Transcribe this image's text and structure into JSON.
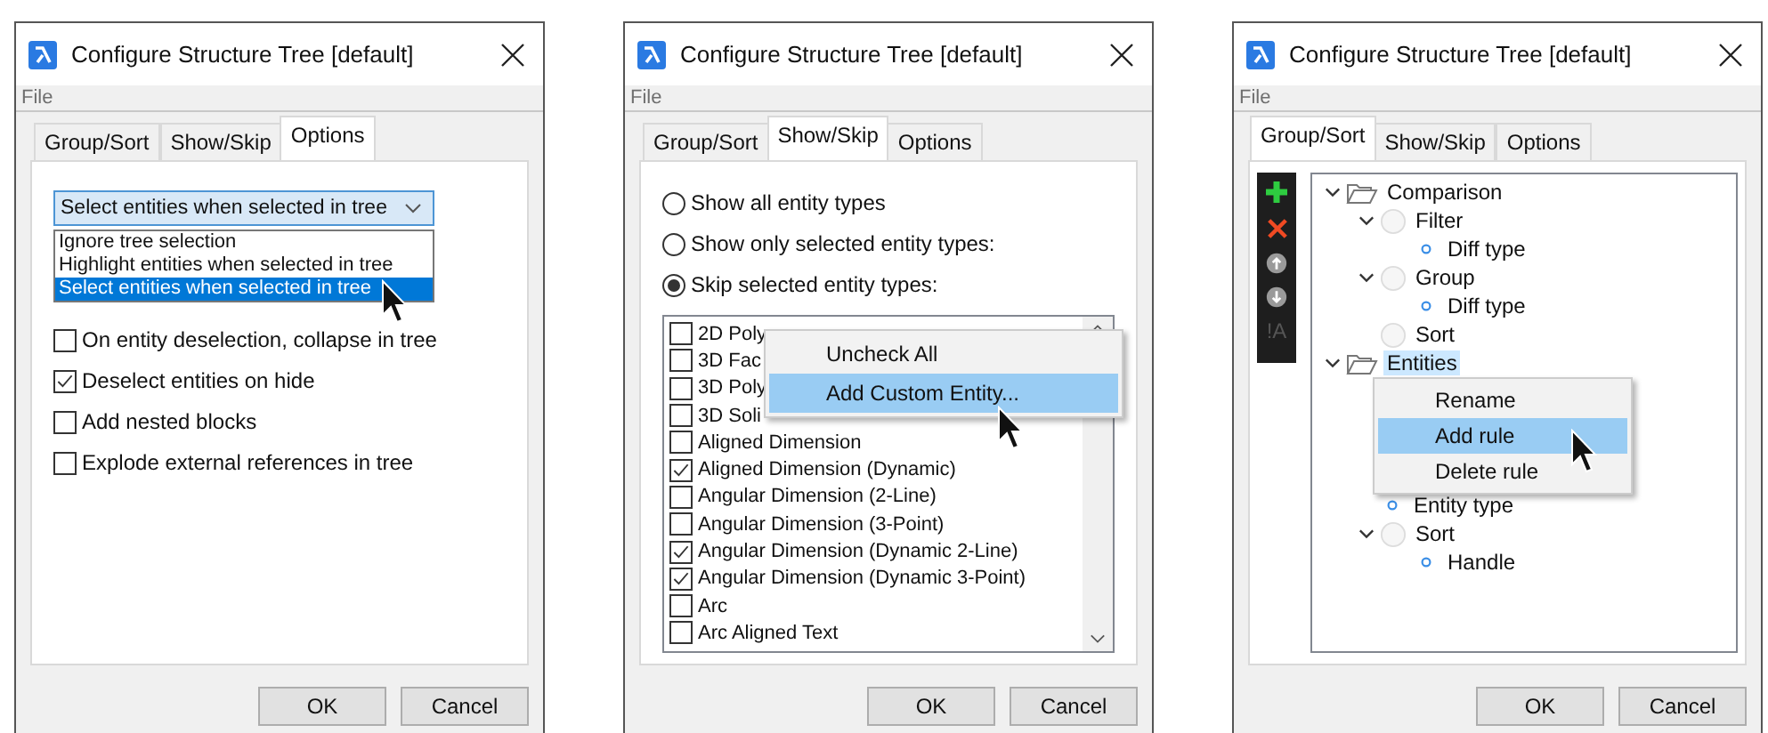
{
  "dialogs": [
    {
      "kind": "options",
      "title": "Configure Structure Tree [default]",
      "menu": [
        "File"
      ],
      "tabs": [
        {
          "label": "Group/Sort",
          "selected": false
        },
        {
          "label": "Show/Skip",
          "selected": false
        },
        {
          "label": "Options",
          "selected": true
        }
      ],
      "combo": {
        "value": "Select entities when selected in tree"
      },
      "dropdown": [
        {
          "label": "Ignore tree selection",
          "selected": false
        },
        {
          "label": "Highlight entities when selected in tree",
          "selected": false
        },
        {
          "label": "Select entities when selected in tree",
          "selected": true
        }
      ],
      "checkboxes": [
        {
          "label": "On entity deselection, collapse in tree",
          "checked": false
        },
        {
          "label": "Deselect entities on hide",
          "checked": true
        },
        {
          "label": "Add nested blocks",
          "checked": false
        },
        {
          "label": "Explode external references in tree",
          "checked": false
        }
      ],
      "buttons": [
        "OK",
        "Cancel"
      ]
    },
    {
      "kind": "show_skip",
      "title": "Configure Structure Tree [default]",
      "menu": [
        "File"
      ],
      "tabs": [
        {
          "label": "Group/Sort",
          "selected": false
        },
        {
          "label": "Show/Skip",
          "selected": true
        },
        {
          "label": "Options",
          "selected": false
        }
      ],
      "radios": [
        {
          "label": "Show all entity types",
          "selected": false
        },
        {
          "label": "Show only selected entity types:",
          "selected": false
        },
        {
          "label": "Skip selected entity types:",
          "selected": true
        }
      ],
      "entities": [
        {
          "label": "2D Poly",
          "checked": false
        },
        {
          "label": "3D Fac",
          "checked": false
        },
        {
          "label": "3D Poly",
          "checked": false
        },
        {
          "label": "3D Soli",
          "checked": false
        },
        {
          "label": "Aligned Dimension",
          "checked": false
        },
        {
          "label": "Aligned Dimension (Dynamic)",
          "checked": true
        },
        {
          "label": "Angular Dimension (2-Line)",
          "checked": false
        },
        {
          "label": "Angular Dimension (3-Point)",
          "checked": false
        },
        {
          "label": "Angular Dimension (Dynamic 2-Line)",
          "checked": true
        },
        {
          "label": "Angular Dimension (Dynamic 3-Point)",
          "checked": true
        },
        {
          "label": "Arc",
          "checked": false
        },
        {
          "label": "Arc Aligned Text",
          "checked": false
        }
      ],
      "context_menu": [
        {
          "label": "Uncheck All",
          "selected": false
        },
        {
          "label": "Add Custom Entity...",
          "selected": true
        }
      ],
      "buttons": [
        "OK",
        "Cancel"
      ]
    },
    {
      "kind": "group_sort",
      "title": "Configure Structure Tree [default]",
      "menu": [
        "File"
      ],
      "tabs": [
        {
          "label": "Group/Sort",
          "selected": true
        },
        {
          "label": "Show/Skip",
          "selected": false
        },
        {
          "label": "Options",
          "selected": false
        }
      ],
      "toolbar_text": "!A",
      "tree": [
        {
          "label": "Comparison",
          "kind": "group",
          "expanded": true,
          "selected": false,
          "children": [
            {
              "label": "Filter",
              "kind": "rule",
              "expanded": true,
              "selected": false,
              "children": [
                {
                  "label": "Diff type",
                  "kind": "field",
                  "selected": false
                }
              ]
            },
            {
              "label": "Group",
              "kind": "rule",
              "expanded": true,
              "selected": false,
              "children": [
                {
                  "label": "Diff type",
                  "kind": "field",
                  "selected": false
                }
              ]
            },
            {
              "label": "Sort",
              "kind": "rule",
              "selected": false
            }
          ]
        },
        {
          "label": "Entities",
          "kind": "group",
          "expanded": true,
          "selected": true,
          "children": [
            {
              "label": "Entity type",
              "kind": "field",
              "selected": false
            },
            {
              "label": "Sort",
              "kind": "rule",
              "expanded": true,
              "selected": false,
              "children": [
                {
                  "label": "Handle",
                  "kind": "field",
                  "selected": false
                }
              ]
            }
          ]
        }
      ],
      "context_menu": [
        {
          "label": "Rename",
          "selected": false
        },
        {
          "label": "Add rule",
          "selected": true
        },
        {
          "label": "Delete rule",
          "selected": false
        }
      ],
      "buttons": [
        "OK",
        "Cancel"
      ]
    }
  ]
}
